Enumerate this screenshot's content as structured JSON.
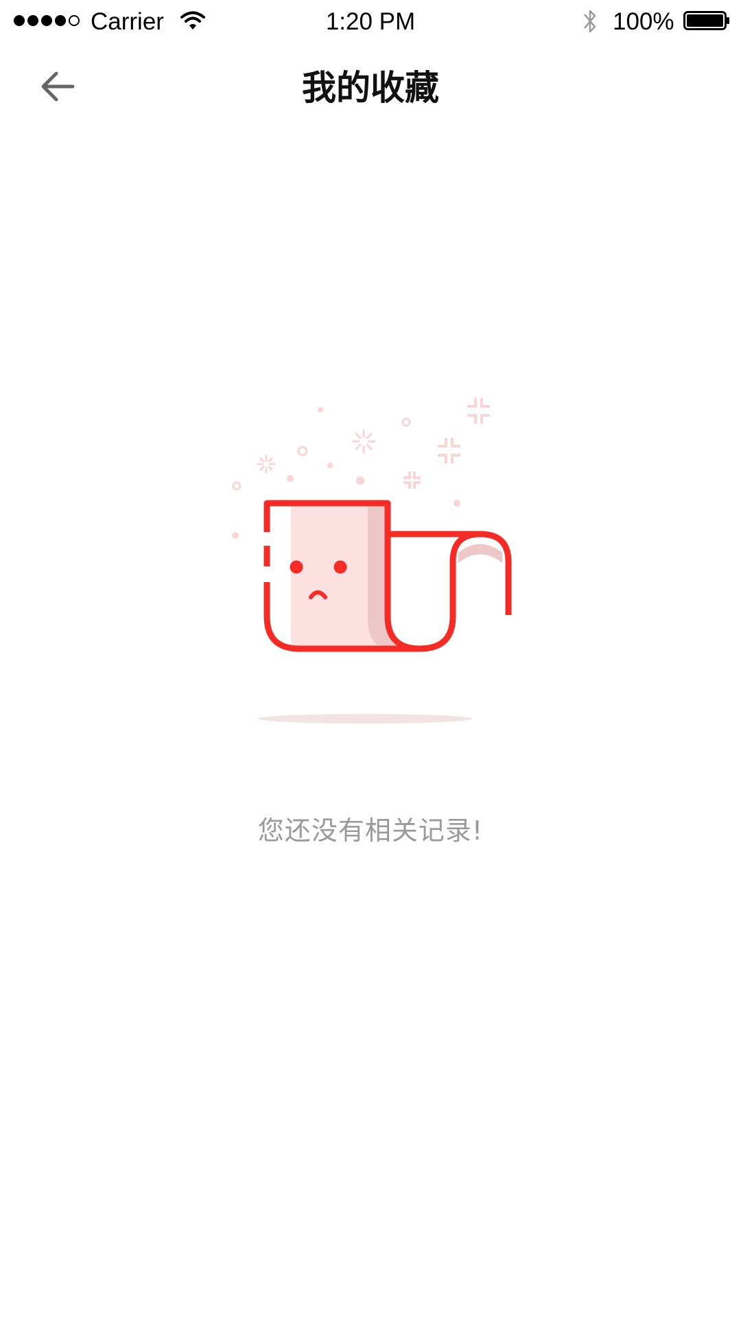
{
  "status_bar": {
    "carrier": "Carrier",
    "time": "1:20 PM",
    "battery_percent": "100%",
    "signal_bars_filled": 4,
    "signal_bars_total": 5
  },
  "nav": {
    "back_icon": "arrow-left-icon",
    "title": "我的收藏"
  },
  "empty_state": {
    "illustration": "sad-tissue-roll-icon",
    "message": "您还没有相关记录!"
  },
  "colors": {
    "accent": "#f52b25",
    "accent_light": "#fde1e1",
    "accent_shadow": "#eec7c7",
    "sparkle": "#fbd4d4",
    "ground_shadow": "#f2e4e4",
    "message_text": "#9a9a9a",
    "back_icon": "#666666"
  }
}
